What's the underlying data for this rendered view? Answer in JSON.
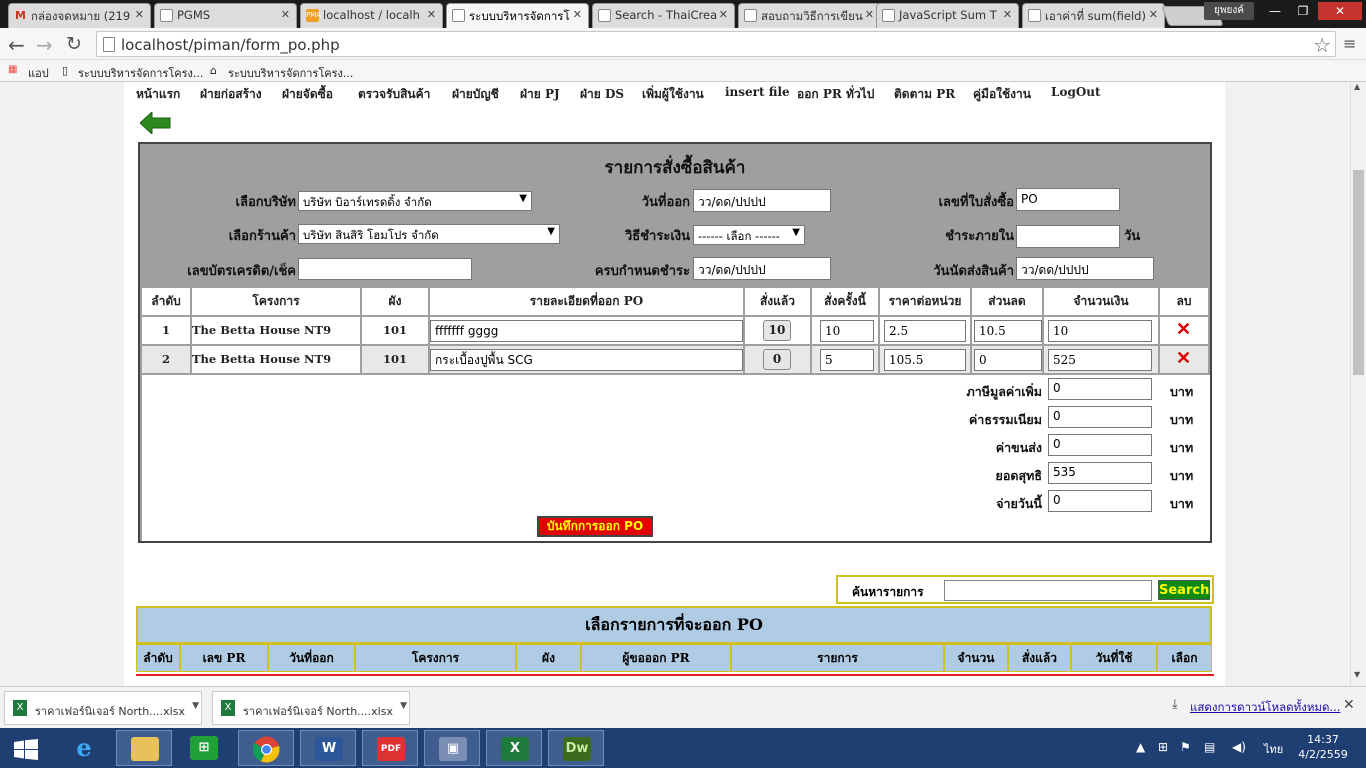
{
  "browser": {
    "tabs": [
      {
        "label": "กล่องจดหมาย (219",
        "icon": "gmail-icon",
        "active": false
      },
      {
        "label": "PGMS",
        "icon": "page-icon",
        "active": false
      },
      {
        "label": "localhost / localh",
        "icon": "phpmyadmin-icon",
        "active": false
      },
      {
        "label": "ระบบบริหารจัดการโ",
        "icon": "page-icon",
        "active": true
      },
      {
        "label": "Search - ThaiCrea",
        "icon": "page-icon",
        "active": false
      },
      {
        "label": "สอบถามวิธีการเขียน",
        "icon": "page-icon",
        "active": false
      },
      {
        "label": "JavaScript Sum T",
        "icon": "page-icon",
        "active": false
      },
      {
        "label": "เอาค่าที่ sum(field)",
        "icon": "page-icon",
        "active": false
      }
    ],
    "user_badge": "ยุพยงค์",
    "url": "localhost/piman/form_po.php",
    "bookmarks": {
      "apps_label": "แอป",
      "items": [
        "ระบบบริหารจัดการโครง...",
        "ระบบบริหารจัดการโครง..."
      ]
    }
  },
  "menu": {
    "items": [
      "หน้าแรก",
      "ฝ่ายก่อสร้าง",
      "ฝ่ายจัดซื้อ",
      "ตรวจรับสินค้า",
      "ฝ่ายบัญชี",
      "ฝ่าย PJ",
      "ฝ่าย DS",
      "เพิ่มผู้ใช้งาน",
      "insert file",
      "ออก PR ทั่วไป",
      "ติดตาม PR",
      "คู่มือใช้งาน",
      "LogOut"
    ]
  },
  "order": {
    "title": "รายการสั่งซื้อสินค้า",
    "company_label": "เลือกบริษัท",
    "company_value": "บริษัท บิอาร์เทรดดิ้ง จำกัด",
    "issue_date_label": "วันที่ออก",
    "issue_date_value": "วว/ดด/ปปปป",
    "po_no_label": "เลขที่ใบสั่งซื้อ",
    "po_no_value": "PO",
    "shop_label": "เลือกร้านค้า",
    "shop_value": "บริษัท สินสิริ โฮมโปร จำกัด",
    "payment_label": "วิธีชำระเงิน",
    "payment_value": "------ เลือก ------",
    "pay_within_label": "ชำระภายใน",
    "pay_within_value": "",
    "days_unit": "วัน",
    "card_label": "เลขบัตรเครดิต/เช็ค",
    "card_value": "",
    "due_label": "ครบกำหนดชำระ",
    "due_value": "วว/ดด/ปปปป",
    "delivery_label": "วันนัดส่งสินค้า",
    "delivery_value": "วว/ดด/ปปปป",
    "columns": [
      "ลำดับ",
      "โครงการ",
      "ผัง",
      "รายละเอียดที่ออก PO",
      "สั่งแล้ว",
      "สั่งครั้งนี้",
      "ราคาต่อหน่วย",
      "ส่วนลด",
      "จำนวนเงิน",
      "ลบ"
    ],
    "rows": [
      {
        "no": "1",
        "project": "The Betta House NT9",
        "plan": "101",
        "detail": "fffffff    gggg",
        "ordered": "10",
        "qty": "10",
        "price": "2.5",
        "discount": "10.5",
        "amount": "10"
      },
      {
        "no": "2",
        "project": "The Betta House NT9",
        "plan": "101",
        "detail": "กระเบื้องปูพื้น    SCG",
        "ordered": "0",
        "qty": "5",
        "price": "105.5",
        "discount": "0",
        "amount": "525"
      }
    ],
    "summary": [
      {
        "label": "ภาษีมูลค่าเพิ่ม",
        "value": "0"
      },
      {
        "label": "ค่าธรรมเนียม",
        "value": "0"
      },
      {
        "label": "ค่าขนส่ง",
        "value": "0"
      },
      {
        "label": "ยอดสุทธิ",
        "value": "535"
      },
      {
        "label": "จ่ายวันนี้",
        "value": "0"
      }
    ],
    "currency": "บาท",
    "save_label": "บันทึกการออก PO"
  },
  "search": {
    "label": "ค้นหารายการ",
    "value": "",
    "button": "Search"
  },
  "select_pr": {
    "title": "เลือกรายการที่จะออก PO",
    "columns": [
      "ลำดับ",
      "เลข PR",
      "วันที่ออก",
      "โครงการ",
      "ผัง",
      "ผู้ขอออก PR",
      "รายการ",
      "จำนวน",
      "สั่งแล้ว",
      "วันที่ใช้",
      "เลือก"
    ]
  },
  "downloads": {
    "items": [
      "ราคาเฟอร์นิเจอร์ North....xlsx",
      "ราคาเฟอร์นิเจอร์ North....xlsx"
    ],
    "show_all": "แสดงการดาวน์โหลดทั้งหมด..."
  },
  "taskbar": {
    "language": "ไทย",
    "time": "14:37",
    "date": "4/2/2559"
  },
  "colors": {
    "accent_red": "#e30000",
    "search_green": "#0a8a15",
    "header_blue": "#b0cbe4",
    "frame_gray": "#9f9f9f"
  }
}
